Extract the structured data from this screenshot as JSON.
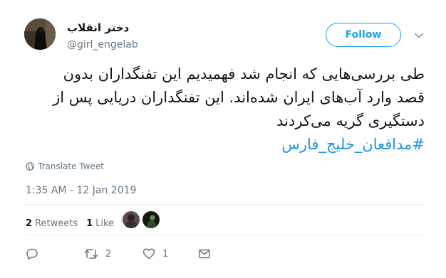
{
  "author": {
    "display_name": "دختر انقلاب",
    "handle": "@girl_engelab",
    "avatar_icon": "profile-photo"
  },
  "follow_label": "Follow",
  "tweet": {
    "line1": "طی بررسی‌هایی که انجام شد فهمیدیم این تفنگداران بدون",
    "line2": "قصد وارد آب‌های ایران شده‌اند. این تفنگداران دریایی پس از",
    "line3": "دستگیری گریه می‌کردند",
    "hashtag": "#مدافعان_خلیج_فارس"
  },
  "translate_label": "Translate Tweet",
  "timestamp": "1:35 AM - 12 Jan 2019",
  "stats": {
    "retweets_count": "2",
    "retweets_label": "Retweets",
    "likes_count": "1",
    "likes_label": "Like"
  },
  "actions": {
    "reply_icon": "reply-icon",
    "retweet_count": "2",
    "like_count": "1",
    "dm_icon": "mail-icon"
  },
  "colors": {
    "brand": "#1da1f2",
    "hashtag": "#1b95e0",
    "muted": "#657786"
  }
}
